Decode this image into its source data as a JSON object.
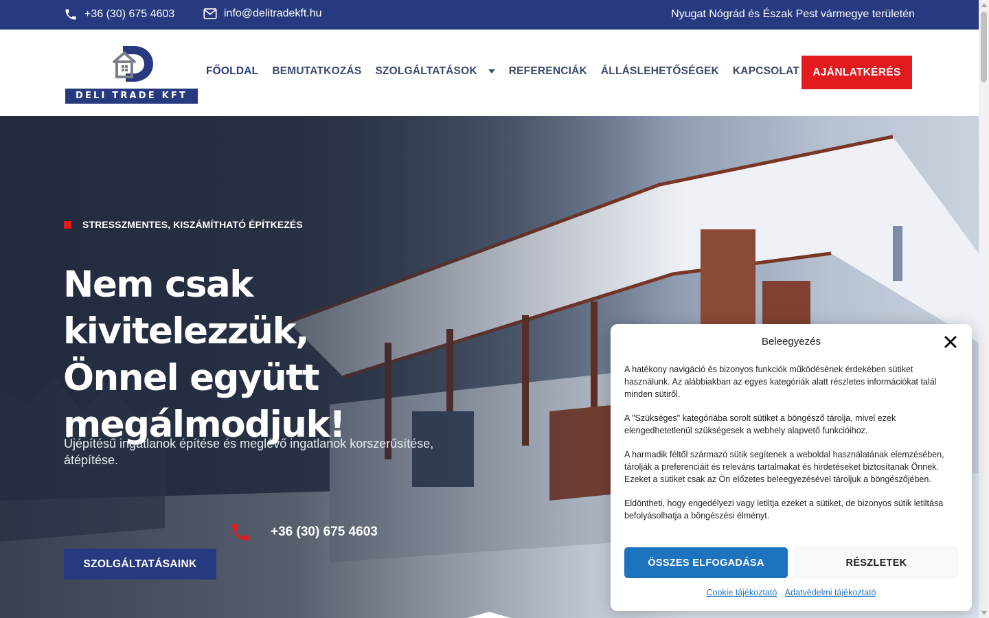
{
  "topbar": {
    "phone": "+36 (30) 675 4603",
    "email": "info@delitradekft.hu",
    "region": "Nyugat Nógrád és Észak Pest vármegye területén",
    "phone_icon": "phone-icon",
    "email_icon": "envelope-icon"
  },
  "logo": {
    "text": "DELI TRADE KFT"
  },
  "nav": {
    "items": [
      {
        "label": "FŐOLDAL",
        "active": true
      },
      {
        "label": "BEMUTATKOZÁS"
      },
      {
        "label": "SZOLGÁLTATÁSOK",
        "has_dropdown": true
      },
      {
        "label": "REFERENCIÁK"
      },
      {
        "label": "ÁLLÁSLEHETŐSÉGEK"
      },
      {
        "label": "KAPCSOLAT"
      }
    ],
    "cta": "AJÁNLATKÉRÉS"
  },
  "hero": {
    "tagline": "STRESSZMENTES, KISZÁMÍTHATÓ ÉPÍTKEZÉS",
    "headline": [
      "Nem csak kivitelezzük,",
      "Önnel együtt",
      "megálmodjuk!"
    ],
    "subtext": "Újépítésű ingatlanok építése és meglévő ingatlanok korszerűsítése, átépítése.",
    "phone": "+36 (30) 675 4603",
    "button": "SZOLGÁLTATÁSAINK"
  },
  "consent": {
    "title": "Beleegyezés",
    "paragraphs": [
      "A hatékony navigáció és bizonyos funkciók működésének érdekében sütiket használunk. Az alábbiakban az egyes kategóriák alatt részletes információkat talál minden sütiről.",
      "A \"Szükséges\" kategóriába sorolt sütiket a böngésző tárolja, mivel ezek elengedhetetlenül szükségesek a webhely alapvető funkcióihoz.",
      "A harmadik féltől származó sütik segítenek a weboldal használatának elemzésében, tárolják a preferenciáit és releváns tartalmakat és hirdetéseket biztosítanak Önnek. Ezeket a sütiket csak az Ön előzetes beleegyezésével tároljuk a böngészőjében.",
      "Eldöntheti, hogy engedélyezi vagy letiltja ezeket a sütiket, de bizonyos sütik letiltása befolyásolhatja a böngészési élményt."
    ],
    "accept": "ÖSSZES ELFOGADÁSA",
    "details": "RÉSZLETEK",
    "links": [
      "Cookie tájékoztató",
      "Adatvédelmi tájékoztató"
    ]
  },
  "colors": {
    "brand_blue": "#27397f",
    "accent_red": "#e11b1f",
    "consent_blue": "#1e73be"
  }
}
